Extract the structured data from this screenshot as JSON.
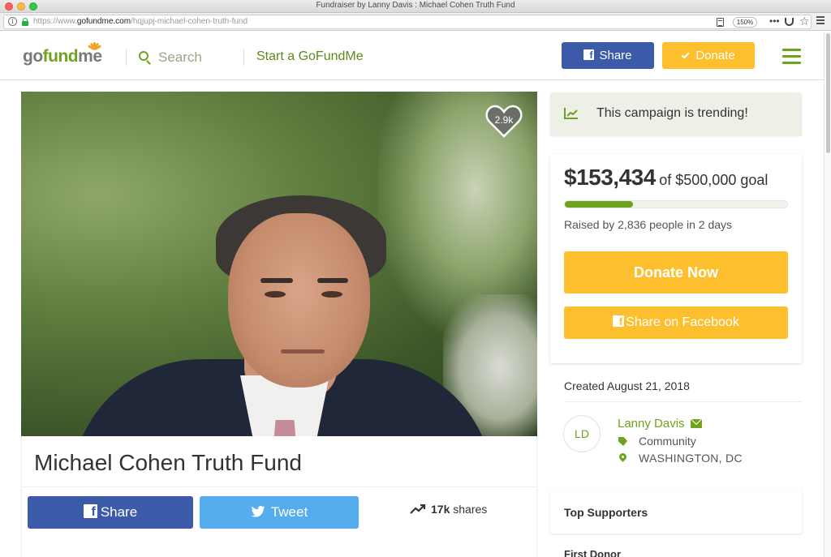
{
  "browser": {
    "window_title": "Fundraiser by Lanny Davis : Michael Cohen Truth Fund",
    "url_domain_prefix": "https://www.",
    "url_domain": "gofundme.com",
    "url_path": "/hqjupj-michael-cohen-truth-fund",
    "zoom": "150%"
  },
  "header": {
    "logo_go": "go",
    "logo_fund": "fund",
    "logo_me": "me",
    "search_label": "Search",
    "start_link": "Start a GoFundMe",
    "share_label": "Share",
    "donate_label": "Donate"
  },
  "campaign": {
    "hearts": "2.9k",
    "title": "Michael Cohen Truth Fund",
    "share_label": "Share",
    "tweet_label": "Tweet",
    "shares_count": "17k",
    "shares_label": "shares"
  },
  "sidebar": {
    "trending_text": "This campaign is trending!",
    "amount_raised": "$153,434",
    "goal_text": "of $500,000 goal",
    "progress_fraction": 0.307,
    "raised_by": "Raised by 2,836 people in 2 days",
    "donate_now_label": "Donate Now",
    "share_facebook_label": "Share on Facebook",
    "created": "Created August 21, 2018",
    "organizer_initials": "LD",
    "organizer_name": "Lanny Davis",
    "category": "Community",
    "location": "WASHINGTON, DC",
    "top_supporters": "Top Supporters",
    "first_donor": "First Donor"
  },
  "colors": {
    "brand_green": "#6ea31d",
    "donate_yellow": "#fdbf2d",
    "facebook_blue": "#3b5aa8",
    "twitter_blue": "#55acee"
  }
}
